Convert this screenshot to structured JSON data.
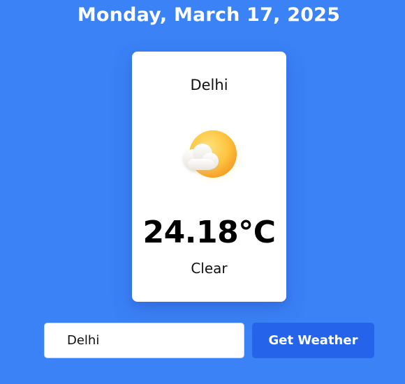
{
  "header": {
    "date": "Monday, March 17, 2025"
  },
  "weather": {
    "city": "Delhi",
    "icon": "partly-cloudy-icon",
    "temperature": "24.18°C",
    "condition": "Clear"
  },
  "search": {
    "value": "Delhi",
    "button_label": "Get Weather"
  },
  "colors": {
    "background": "#3b82f6",
    "button": "#2563eb",
    "card": "#ffffff"
  }
}
